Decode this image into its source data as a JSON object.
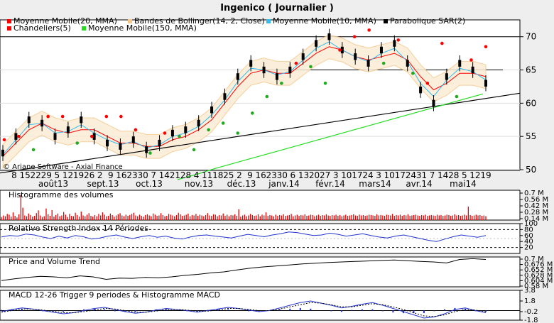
{
  "title": "Ingenico  ( Journalier )",
  "legend": [
    {
      "label": "Moyenne Mobile(20, MMA)",
      "color": "#ff0000"
    },
    {
      "label": "Bandes de Bollinger(14, 2, Close)",
      "color": "#f5c78a"
    },
    {
      "label": "Moyenne Mobile(10, MMA)",
      "color": "#33bbee"
    },
    {
      "label": "Parabolique SAR(2)",
      "color": "#000000"
    },
    {
      "label": "Chandeliers(5)",
      "color": "#ff0000"
    },
    {
      "label": "Moyenne Mobile(150, MMA)",
      "color": "#22dd22"
    }
  ],
  "watermark": "© Ariane Software - Axial Finance",
  "colors": {
    "sar": "#ff0000",
    "sar_up": "#22aa22",
    "mm20": "#ff0000",
    "mm10": "#33bbee",
    "mm150": "#22dd22",
    "band": "#f5c78a",
    "vol": "#ee0000",
    "rsi": "#2233cc",
    "macd": "#2233cc",
    "pvt": "#000000"
  },
  "day_labels": [
    "8",
    "15",
    "22",
    "29",
    "5",
    "12",
    "19",
    "26",
    "2",
    "9",
    "16",
    "23",
    "30",
    "7",
    "14",
    "21",
    "28",
    "4",
    "11",
    "18",
    "25",
    "2",
    "9",
    "16",
    "23",
    "30",
    "6",
    "13",
    "20",
    "27",
    "3",
    "10",
    "17",
    "24",
    "3",
    "10",
    "17",
    "24",
    "31",
    "7",
    "14",
    "28",
    "5",
    "12",
    "19"
  ],
  "month_labels": [
    "août13",
    "sept.13",
    "oct.13",
    "nov.13",
    "déc.13",
    "janv.14",
    "févr.14",
    "mars14",
    "avr.14",
    "mai14"
  ],
  "panels": {
    "volume": {
      "label": "Histogramme des volumes",
      "ticks": [
        "0.7 M",
        "0.56 M",
        "0.42 M",
        "0.28 M",
        "0.14 M"
      ]
    },
    "rsi": {
      "label": "Relative Strength Index 14 Périodes",
      "ticks": [
        "100",
        "80",
        "60",
        "40",
        "20"
      ]
    },
    "pvt": {
      "label": "Price and Volume Trend",
      "ticks": [
        "0.7 M",
        "0.676 M",
        "0.652 M",
        "0.628 M",
        "0.604 M",
        "0.58 M"
      ]
    },
    "macd": {
      "label": "MACD 12-26   Trigger 9 periodes & Histogramme MACD",
      "ticks": [
        "3.8",
        "1.8",
        "-0.2",
        "-1.8"
      ]
    }
  },
  "chart_data": [
    {
      "type": "line",
      "title": "Ingenico  ( Journalier )",
      "yticks": [
        50,
        55,
        60,
        65,
        70
      ],
      "ylim": [
        50,
        72
      ],
      "grid": true,
      "legend_placement": "top",
      "x_periods": [
        "août13",
        "sept.13",
        "oct.13",
        "nov.13",
        "déc.13",
        "janv.14",
        "févr.14",
        "mars14",
        "avr.14",
        "mai14"
      ],
      "series": [
        {
          "name": "Chandeliers(5)",
          "values": [
            52.5,
            55.0,
            57.5,
            57.0,
            55.0,
            56.0,
            57.5,
            55.0,
            54.0,
            53.5,
            54.5,
            53.0,
            54.0,
            55.5,
            56.0,
            57.0,
            59.0,
            61.0,
            64.0,
            66.0,
            65.0,
            64.0,
            65.0,
            67.0,
            69.0,
            70.0,
            68.0,
            67.0,
            66.0,
            68.0,
            69.0,
            66.0,
            62.0,
            60.0,
            64.0,
            66.0,
            65.0,
            63.0
          ]
        },
        {
          "name": "Moyenne Mobile(20, MMA)",
          "values": [
            52.0,
            54.0,
            56.0,
            57.0,
            56.0,
            55.5,
            56.0,
            56.0,
            55.0,
            54.0,
            54.0,
            53.5,
            53.5,
            54.5,
            55.0,
            56.0,
            57.5,
            60.0,
            62.5,
            64.5,
            65.0,
            64.5,
            64.5,
            66.0,
            67.5,
            68.5,
            68.0,
            67.0,
            66.5,
            67.0,
            67.5,
            66.5,
            64.0,
            62.0,
            63.0,
            64.5,
            64.5,
            64.0
          ]
        },
        {
          "name": "Moyenne Mobile(150, MMA)",
          "values": [
            48.5,
            49.3,
            50.2,
            51.0,
            51.8,
            52.6,
            53.4,
            54.2,
            55.0,
            55.8,
            56.6,
            57.4,
            58.2,
            59.0,
            59.8,
            60.6,
            61.4
          ]
        }
      ],
      "sar_points": [
        54.5,
        55.0,
        53.0,
        58.0,
        58.0,
        54.0,
        55.0,
        58.0,
        58.0,
        56.0,
        52.5,
        55.5,
        55.0,
        53.0,
        56.0,
        57.0,
        55.5,
        58.5,
        61.0,
        63.0,
        66.0,
        65.5,
        63.0,
        68.0,
        70.0,
        71.0,
        66.0,
        69.5,
        64.5,
        63.0,
        69.0,
        61.0,
        66.5,
        68.5
      ]
    },
    {
      "type": "bar",
      "title": "Histogramme des volumes",
      "yticks": [
        "0.7 M",
        "0.56 M",
        "0.42 M",
        "0.28 M",
        "0.14 M"
      ],
      "values": [
        0.08,
        0.12,
        0.1,
        0.16,
        0.14,
        0.09,
        0.2,
        0.11,
        0.07,
        0.15,
        0.66,
        0.32,
        0.12,
        0.1,
        0.17,
        0.13,
        0.09,
        0.11,
        0.18,
        0.25,
        0.12,
        0.08,
        0.1,
        0.3,
        0.15,
        0.11,
        0.26,
        0.09,
        0.13,
        0.17,
        0.1,
        0.12,
        0.21,
        0.14,
        0.08,
        0.16,
        0.11,
        0.1,
        0.19,
        0.13,
        0.09,
        0.22,
        0.12,
        0.1,
        0.14,
        0.18,
        0.11,
        0.09,
        0.13,
        0.1,
        0.16,
        0.12,
        0.2,
        0.14,
        0.1,
        0.11,
        0.17,
        0.13,
        0.09,
        0.12,
        0.15,
        0.18,
        0.12,
        0.1,
        0.14,
        0.11,
        0.13,
        0.16,
        0.19,
        0.12,
        0.1,
        0.14,
        0.11,
        0.09,
        0.13,
        0.15,
        0.12,
        0.1,
        0.17,
        0.14,
        0.11,
        0.12,
        0.18,
        0.13,
        0.1,
        0.11,
        0.16,
        0.14,
        0.12,
        0.1,
        0.13,
        0.19,
        0.15,
        0.11,
        0.12,
        0.14,
        0.17,
        0.1,
        0.13,
        0.12,
        0.16,
        0.11,
        0.14,
        0.12,
        0.1,
        0.13,
        0.18,
        0.12,
        0.11,
        0.15,
        0.14,
        0.1,
        0.13,
        0.12,
        0.17,
        0.11,
        0.14,
        0.1,
        0.13,
        0.12,
        0.15,
        0.11,
        0.28,
        0.09,
        0.12,
        0.14,
        0.1,
        0.12,
        0.16,
        0.13,
        0.11,
        0.12,
        0.15,
        0.1,
        0.14,
        0.12,
        0.2,
        0.11,
        0.13,
        0.12,
        0.1,
        0.14,
        0.11,
        0.13,
        0.12,
        0.15,
        0.11,
        0.12,
        0.13,
        0.16,
        0.1,
        0.12,
        0.14,
        0.11,
        0.13,
        0.12,
        0.15,
        0.11,
        0.12,
        0.14,
        0.13,
        0.1,
        0.12,
        0.14,
        0.11,
        0.13,
        0.12,
        0.15,
        0.12,
        0.11,
        0.13,
        0.12,
        0.14,
        0.11,
        0.13,
        0.1,
        0.12,
        0.14,
        0.11,
        0.12,
        0.13,
        0.15,
        0.12,
        0.11,
        0.14,
        0.12,
        0.13,
        0.11,
        0.12,
        0.14,
        0.13,
        0.12,
        0.11,
        0.15,
        0.12,
        0.13,
        0.12,
        0.11,
        0.14,
        0.13,
        0.12,
        0.16,
        0.11,
        0.13,
        0.12,
        0.14,
        0.11,
        0.13,
        0.12,
        0.15,
        0.11,
        0.12,
        0.13,
        0.14,
        0.12,
        0.11,
        0.13,
        0.12,
        0.14,
        0.11,
        0.12,
        0.13,
        0.12,
        0.11,
        0.14,
        0.12,
        0.13,
        0.11,
        0.12,
        0.14,
        0.13,
        0.11,
        0.12,
        0.15,
        0.12,
        0.13,
        0.11,
        0.12,
        0.14,
        0.12,
        0.35,
        0.13,
        0.11,
        0.12,
        0.14,
        0.12,
        0.13,
        0.11,
        0.12,
        0.1
      ]
    },
    {
      "type": "line",
      "title": "Relative Strength Index 14 Périodes",
      "yticks": [
        100,
        80,
        60,
        40,
        20
      ],
      "levels": [
        80,
        20
      ],
      "values": [
        55,
        60,
        58,
        65,
        62,
        55,
        50,
        58,
        52,
        60,
        56,
        48,
        52,
        58,
        62,
        55,
        50,
        56,
        60,
        54,
        58,
        52,
        48,
        55,
        60,
        62,
        58,
        55,
        52,
        58,
        64,
        60,
        56,
        62,
        66,
        72,
        70,
        65,
        60,
        62,
        68,
        64,
        58,
        62,
        66,
        60,
        55,
        52,
        58,
        62,
        56,
        50,
        44,
        40,
        48,
        56,
        62,
        58,
        54,
        60
      ]
    },
    {
      "type": "line",
      "title": "Price and Volume Trend",
      "yticks": [
        "0.7 M",
        "0.676 M",
        "0.652 M",
        "0.628 M",
        "0.604 M",
        "0.58 M"
      ],
      "values": [
        0.605,
        0.612,
        0.618,
        0.622,
        0.62,
        0.616,
        0.624,
        0.62,
        0.61,
        0.615,
        0.614,
        0.618,
        0.616,
        0.62,
        0.626,
        0.63,
        0.636,
        0.64,
        0.648,
        0.655,
        0.66,
        0.664,
        0.668,
        0.672,
        0.675,
        0.678,
        0.68,
        0.682,
        0.684,
        0.686,
        0.688,
        0.685,
        0.682,
        0.68,
        0.676,
        0.69,
        0.693,
        0.69
      ]
    },
    {
      "type": "line",
      "title": "MACD 12-26   Trigger 9 periodes & Histogramme MACD",
      "yticks": [
        3.8,
        1.8,
        -0.2,
        -1.8
      ],
      "series": [
        {
          "name": "MACD 12-26",
          "values": [
            -0.2,
            0.2,
            0.5,
            0.3,
            0.0,
            -0.3,
            -0.6,
            -0.4,
            0.0,
            0.4,
            0.6,
            0.2,
            -0.2,
            -0.5,
            -0.3,
            0.1,
            0.4,
            0.2,
            0.0,
            -0.3,
            0.0,
            0.3,
            0.6,
            0.4,
            0.1,
            -0.2,
            0.0,
            0.5,
            1.0,
            1.5,
            1.8,
            1.4,
            1.0,
            0.5,
            0.8,
            1.2,
            1.5,
            1.0,
            0.4,
            -0.2,
            -0.8,
            -1.4,
            -1.2,
            -0.6,
            0.2,
            0.5,
            0.0,
            -0.4
          ]
        },
        {
          "name": "Trigger 9 periodes",
          "values": [
            -0.3,
            0.0,
            0.3,
            0.3,
            0.1,
            -0.1,
            -0.4,
            -0.4,
            -0.2,
            0.1,
            0.4,
            0.3,
            0.0,
            -0.3,
            -0.3,
            -0.1,
            0.2,
            0.2,
            0.1,
            -0.1,
            -0.1,
            0.1,
            0.4,
            0.4,
            0.2,
            0.0,
            0.0,
            0.3,
            0.7,
            1.1,
            1.5,
            1.4,
            1.1,
            0.7,
            0.7,
            1.0,
            1.3,
            1.1,
            0.7,
            0.2,
            -0.4,
            -1.0,
            -1.1,
            -0.8,
            -0.2,
            0.2,
            0.1,
            -0.2
          ]
        }
      ]
    }
  ]
}
